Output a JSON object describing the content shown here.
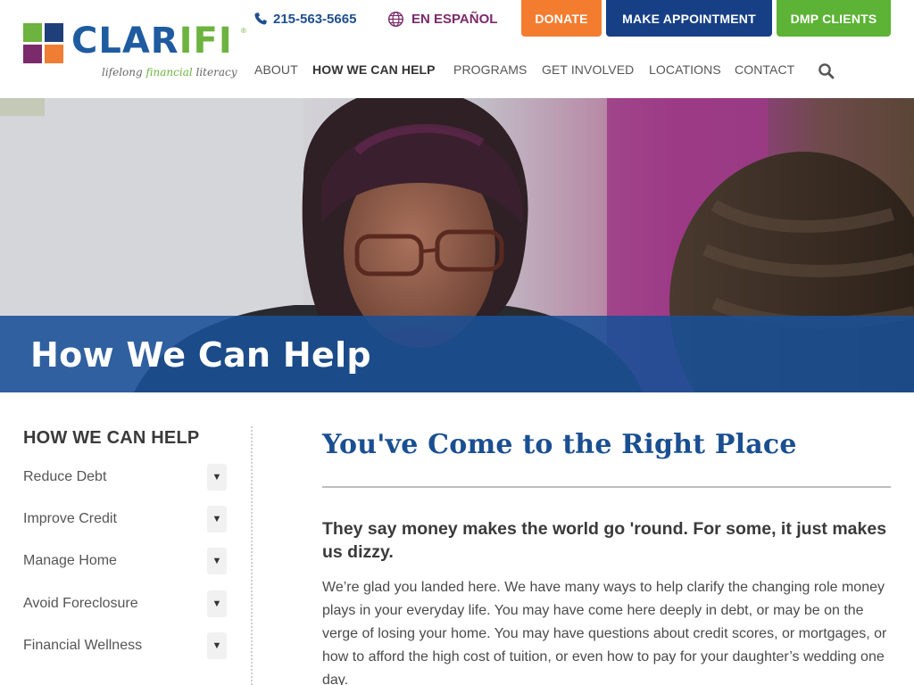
{
  "header": {
    "logo": {
      "word_main": "CLAR",
      "word_accent": "IFI",
      "registered": "®",
      "tagline_pre": "lifelong ",
      "tagline_mid": "financial",
      "tagline_post": " literacy",
      "colors": {
        "green": "#6db33f",
        "navy": "#1f3f7a",
        "purple": "#7b2a6b",
        "orange": "#ef7d33",
        "blue": "#1f5ba0"
      }
    },
    "phone": {
      "icon": "phone-icon",
      "text": "215-563-5665"
    },
    "language": {
      "icon": "globe-icon",
      "text": "EN ESPAÑOL"
    },
    "buttons": {
      "donate": {
        "label": "DONATE",
        "color": "#f47c2f"
      },
      "appointment": {
        "label": "MAKE APPOINTMENT",
        "color": "#173f86"
      },
      "dmp": {
        "label": "DMP CLIENTS",
        "color": "#5cb335"
      }
    },
    "nav": [
      {
        "label": "ABOUT",
        "active": false
      },
      {
        "label": "HOW WE CAN HELP",
        "active": true
      },
      {
        "label": "PROGRAMS",
        "active": false
      },
      {
        "label": "GET INVOLVED",
        "active": false
      },
      {
        "label": "LOCATIONS",
        "active": false
      },
      {
        "label": "CONTACT",
        "active": false
      }
    ],
    "search_icon": "search-icon"
  },
  "hero": {
    "title": "How We Can Help",
    "band_color": "#1e5296"
  },
  "sidebar": {
    "title": "HOW WE CAN HELP",
    "toggle_glyph": "▼",
    "items": [
      {
        "label": "Reduce Debt"
      },
      {
        "label": "Improve Credit"
      },
      {
        "label": "Manage Home"
      },
      {
        "label": "Avoid Foreclosure"
      },
      {
        "label": "Financial Wellness"
      }
    ]
  },
  "main": {
    "title": "You've Come to the Right Place",
    "lead": "They say money makes the world go 'round. For some, it just makes us dizzy.",
    "body": "We’re glad you landed here. We have many ways to help clarify the changing role money plays in your everyday life. You may have come here deeply in debt, or may be on the verge of losing your home. You may have questions about credit scores, or mortgages, or how to afford the high cost of tuition, or even how to pay for your daughter’s wedding one day."
  }
}
